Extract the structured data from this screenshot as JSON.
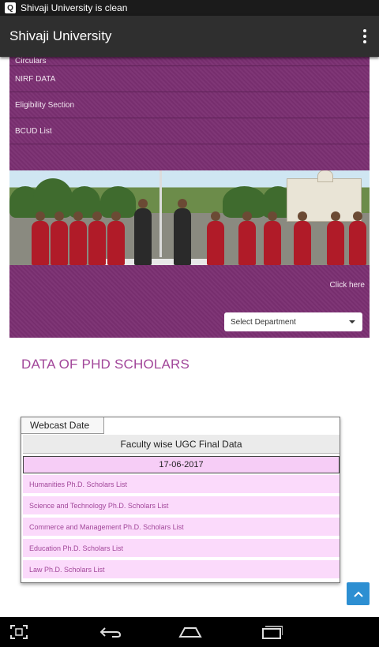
{
  "status_bar": {
    "notification_text": "Shivaji University is clean",
    "notification_icon": "Q"
  },
  "app_bar": {
    "title": "Shivaji University",
    "overflow_icon": "more-vert-icon"
  },
  "menu": {
    "items": [
      {
        "label": "Circulars"
      },
      {
        "label": "NIRF DATA"
      },
      {
        "label": "Eligibility Section"
      },
      {
        "label": "BCUD List"
      }
    ]
  },
  "banner": {
    "click_here": "Click here"
  },
  "department_select": {
    "selected": "Select Department"
  },
  "section": {
    "heading": "DATA OF PHD SCHOLARS"
  },
  "table": {
    "tab_label": "Webcast Date",
    "title": "Faculty wise UGC Final Data",
    "date": "17-06-2017",
    "rows": [
      {
        "label": "Humanities Ph.D. Scholars List"
      },
      {
        "label": "Science and Technology Ph.D. Scholars List"
      },
      {
        "label": "Commerce and Management Ph.D. Scholars List"
      },
      {
        "label": "Education Ph.D. Scholars List"
      },
      {
        "label": "Law Ph.D. Scholars List"
      }
    ]
  },
  "colors": {
    "brand_purple": "#7b2f72",
    "heading_purple": "#a2479a",
    "row_pink": "#fbdafb",
    "scroll_button_blue": "#2d8fd2"
  }
}
